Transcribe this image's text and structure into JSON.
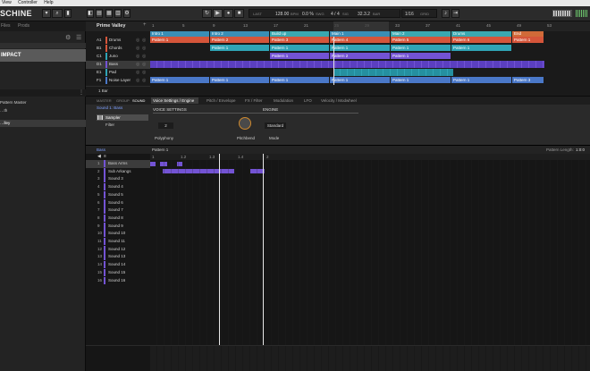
{
  "menu": {
    "items": [
      "View",
      "Controller",
      "Help"
    ]
  },
  "header": {
    "logo": "SCHINE",
    "bpm": "128.00",
    "bpm_unit": "BPM",
    "swing": "0.0 %",
    "signature": "4 / 4",
    "position": "32.3.2",
    "grid": "1/16",
    "arranger_label": "LAST",
    "swing_label": "SWG",
    "sig_label": "SIG",
    "pos_label": "BAR",
    "grid_label": "GRID",
    "tempo_label": "TEMPO"
  },
  "browser": {
    "tabs": [
      "Files",
      "Prods"
    ],
    "header_label": "IMPACT",
    "items": [
      "Pattern Master",
      "…th",
      "…lley"
    ]
  },
  "arranger": {
    "project": "Prime Valley",
    "sections": [
      {
        "label": "Intro 1",
        "color": "#3a8eb5"
      },
      {
        "label": "Intro 2",
        "color": "#3a8eb5"
      },
      {
        "label": "Build up",
        "color": "#3aa8b0"
      },
      {
        "label": "Main 1",
        "color": "#3a8eb5"
      },
      {
        "label": "Main 2",
        "color": "#3aa8b0"
      },
      {
        "label": "Drums",
        "color": "#3aa8b0"
      },
      {
        "label": "End",
        "color": "#d06a38"
      }
    ],
    "groups": [
      {
        "id": "A1",
        "name": "Drums"
      },
      {
        "id": "B1",
        "name": "Chords"
      },
      {
        "id": "C1",
        "name": "Juno"
      },
      {
        "id": "D1",
        "name": "Bass"
      },
      {
        "id": "E1",
        "name": "Pad"
      },
      {
        "id": "F1",
        "name": "Noise Layer"
      }
    ],
    "patterns": [
      [
        "Pattern 1",
        "Pattern 2",
        "Pattern 3",
        "Pattern 4",
        "Pattern 5",
        "Pattern 6",
        "Pattern 1"
      ],
      [
        "",
        "Pattern 1",
        "Pattern 1",
        "Pattern 1",
        "Pattern 1",
        "Pattern 1",
        ""
      ],
      [
        "",
        "",
        "Pattern 1",
        "Pattern 2",
        "Pattern 1",
        "",
        ""
      ],
      [
        "",
        "",
        "",
        "",
        "",
        "",
        ""
      ],
      [
        "",
        "",
        "",
        "",
        "",
        "",
        ""
      ],
      [
        "Pattern 1",
        "Pattern 1",
        "Pattern 1",
        "Pattern 1",
        "Pattern 1",
        "Pattern 1",
        "Pattern 3"
      ]
    ],
    "footer": "1 Bar",
    "ruler": [
      "1",
      "5",
      "9",
      "13",
      "17",
      "21",
      "25",
      "29",
      "33",
      "37",
      "41",
      "45",
      "49",
      "53"
    ]
  },
  "panel": {
    "tabs": [
      "MASTER",
      "GROUP",
      "SOUND"
    ],
    "active_tab": "SOUND",
    "page_tabs": [
      "Voice Settings / Engine",
      "Pitch / Envelope",
      "FX / Filter",
      "Modulation",
      "LFO",
      "Velocity / Modwheel"
    ],
    "sound_label": "Sound 1: Bass",
    "plugins": [
      "Sampler",
      "Filter"
    ],
    "voice_settings": "VOICE SETTINGS",
    "engine": "ENGINE",
    "polyphony_value": "2",
    "polyphony_label": "Polyphony",
    "pitchbend_label": "Pitchbend",
    "mode_value": "Standard",
    "mode_label": "Mode"
  },
  "pattern": {
    "group": "Bass",
    "name": "Pattern 1",
    "length_label": "Pattern Length:",
    "length_value": "1:0:0",
    "ruler": [
      "1",
      "1.2",
      "1.3",
      "1.4",
      "2"
    ],
    "sounds": [
      "Bass Arms",
      "Sub Arkangs",
      "Sound 3",
      "Sound 4",
      "Sound 5",
      "Sound 6",
      "Sound 7",
      "Sound 8",
      "Sound 9",
      "Sound 10",
      "Sound 11",
      "Sound 12",
      "Sound 13",
      "Sound 14",
      "Sound 15",
      "Sound 16"
    ]
  },
  "colors": {
    "accent": "#7353d4",
    "drums": "#d5553a",
    "chords": "#2fa4b5",
    "bass": "#4a78c8"
  }
}
